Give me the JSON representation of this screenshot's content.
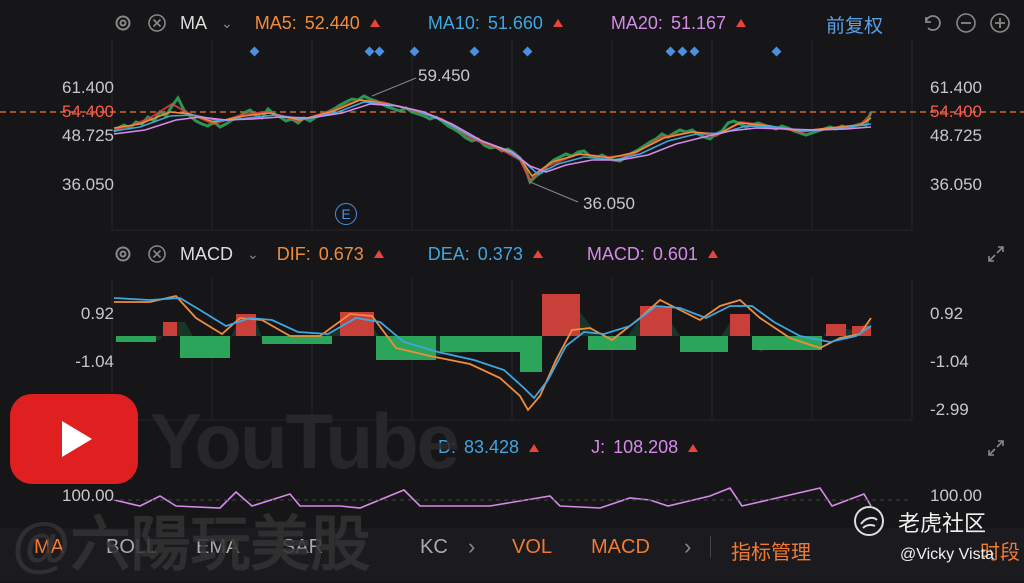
{
  "main_panel": {
    "indicator": "MA",
    "ma5_label": "MA5:",
    "ma5_value": "52.440",
    "ma10_label": "MA10:",
    "ma10_value": "51.660",
    "ma20_label": "MA20:",
    "ma20_value": "51.167",
    "adjust_mode": "前复权",
    "axis_left": [
      "61.400",
      "54.400",
      "48.725",
      "36.050"
    ],
    "axis_right": [
      "61.400",
      "54.400",
      "48.725",
      "36.050"
    ],
    "high_label": "59.450",
    "low_label": "36.050",
    "event_marker": "E"
  },
  "macd_panel": {
    "indicator": "MACD",
    "dif_label": "DIF:",
    "dif_value": "0.673",
    "dea_label": "DEA:",
    "dea_value": "0.373",
    "macd_label": "MACD:",
    "macd_value": "0.601",
    "axis_left": [
      "0.92",
      "-1.04"
    ],
    "axis_right": [
      "0.92",
      "-1.04",
      "-2.99"
    ]
  },
  "kdj_panel": {
    "d_label": "D:",
    "d_value": "83.428",
    "j_label": "J:",
    "j_value": "108.208",
    "axis_left": [
      "100.00"
    ],
    "axis_right": [
      "100.00"
    ]
  },
  "bottom_tabs": [
    "MA",
    "BOLL",
    "EMA",
    "SAR",
    "KC",
    "VOL",
    "MACD",
    "指标管理",
    "时段"
  ],
  "watermarks": {
    "youtube_text": "YouTube",
    "channel": "@六陽玩美股",
    "community": "老虎社区",
    "user": "@Vicky Vista"
  },
  "colors": {
    "up": "#e8443a",
    "down": "#2aa55a",
    "ma5": "#f08c3a",
    "ma10": "#3fa6e0",
    "ma20": "#d58ae8",
    "price_line": "#f07a32"
  }
}
